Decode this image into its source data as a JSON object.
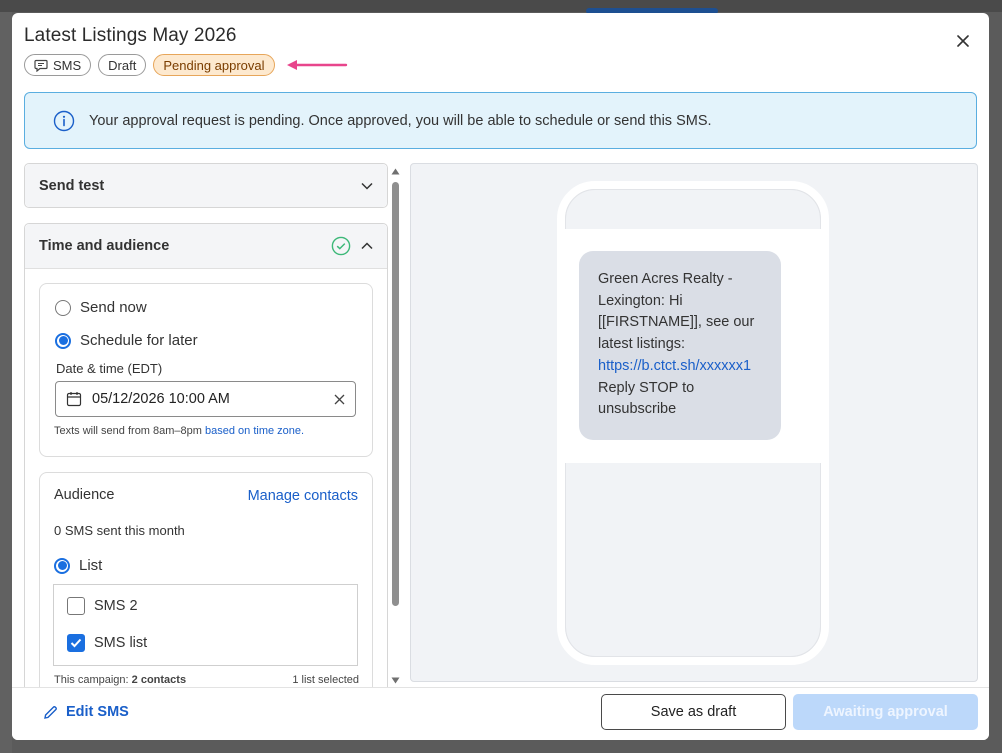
{
  "dialog": {
    "title": "Latest Listings May 2026",
    "pills": {
      "type": "SMS",
      "status": "Draft",
      "approval": "Pending approval"
    }
  },
  "banner": {
    "text": "Your approval request is pending. Once approved, you will be able to schedule or send this SMS."
  },
  "send_test": {
    "title": "Send test"
  },
  "time_audience": {
    "title": "Time and audience",
    "options": {
      "send_now": "Send now",
      "schedule_later": "Schedule for later"
    },
    "selected_option": "schedule_later",
    "date_label": "Date & time (EDT)",
    "date_value": "05/12/2026 10:00 AM",
    "helper_text": "Texts will send from 8am–8pm",
    "helper_link": "based on time zone."
  },
  "audience": {
    "title": "Audience",
    "manage_link": "Manage contacts",
    "sms_count": "0 SMS sent this month",
    "list_option": "List",
    "lists": [
      {
        "name": "SMS 2",
        "checked": false
      },
      {
        "name": "SMS list",
        "checked": true
      }
    ],
    "campaign_label": "This campaign:",
    "campaign_value": "2 contacts",
    "lists_selected": "1 list selected"
  },
  "preview": {
    "message_before_link": "Green Acres Realty - Lexington: Hi [[FIRSTNAME]], see our latest listings:",
    "message_link": "https://b.ctct.sh/xxxxxx1",
    "message_after_link": "Reply STOP to unsubscribe"
  },
  "footer": {
    "edit_label": "Edit SMS",
    "draft_label": "Save as draft",
    "await_label": "Awaiting approval"
  },
  "colors": {
    "accent": "#1a5fc9",
    "pending_bg": "#fde9cf",
    "pending_border": "#e7a65a",
    "banner_bg": "#e3f3fb",
    "banner_border": "#5aaee0",
    "arrow": "#e8458c",
    "success": "#3cb878"
  }
}
